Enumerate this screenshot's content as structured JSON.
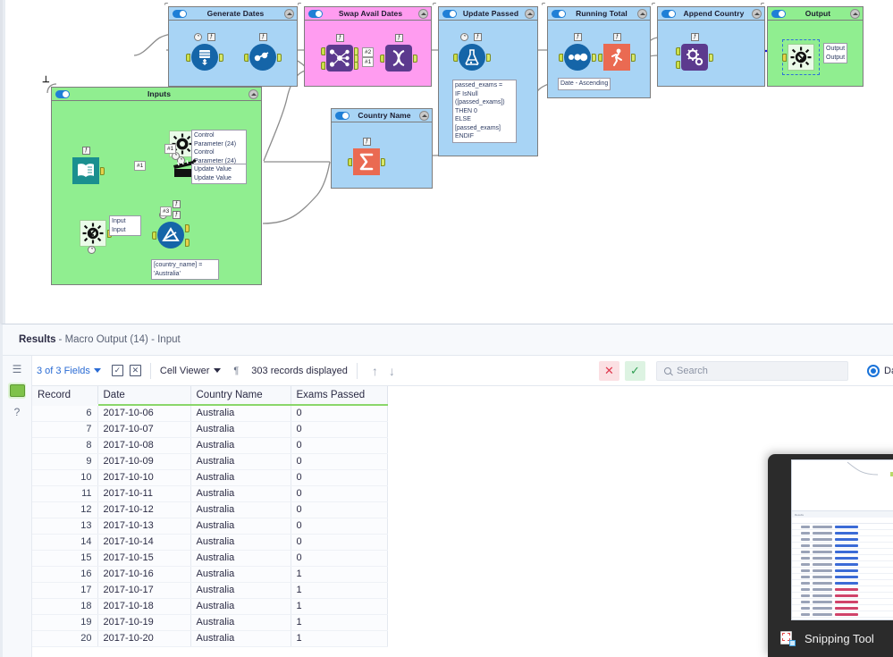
{
  "canvas": {
    "containers": [
      {
        "name": "Generate Dates",
        "color": "#a8d4f5"
      },
      {
        "name": "Swap Avail Dates",
        "color": "#ff9cf0"
      },
      {
        "name": "Update Passed",
        "color": "#a8d4f5"
      },
      {
        "name": "Running Total",
        "color": "#a8d4f5"
      },
      {
        "name": "Append Country",
        "color": "#a8d4f5"
      },
      {
        "name": "Output",
        "color": "#90ee90"
      },
      {
        "name": "Inputs",
        "color": "#90ee90"
      },
      {
        "name": "Country Name",
        "color": "#a8d4f5"
      }
    ],
    "notes": {
      "update_passed_formula": "passed_exams =\nIF IsNull\n([passed_exams])\nTHEN 0\nELSE\n[passed_exams]\nENDIF",
      "running_total_sort": "Date - Ascending",
      "output_label": "Output\nOutput",
      "control_parameter": "Control\nParameter (24)\nControl\nParameter (24)",
      "update_value": "Update Value\nUpdate Value",
      "macro_input_label": "Input\nInput",
      "filter_expression": "[country_name] =\n'Australia'"
    },
    "connection_labels": {
      "join_label": "#2",
      "text_input_label": "#1",
      "action_label": "#1",
      "filter_label": "#3"
    }
  },
  "results": {
    "header": {
      "lead": "Results",
      "sub": "- Macro Output (14) - Input"
    },
    "toolbar": {
      "fields_label": "3 of 3 Fields",
      "select_all_icon": "checkbox-icon",
      "deselect_all_icon": "x-box-icon",
      "cell_viewer_label": "Cell Viewer",
      "pilcrow_icon": "pilcrow-icon",
      "records_label": "303 records displayed",
      "up_arrow": "↑",
      "down_arrow": "↓",
      "cancel_label": "✕",
      "confirm_label": "✓",
      "search_placeholder": "Search",
      "data_radio_label": "Da"
    },
    "rail": {
      "list_icon": "list-icon",
      "data-chip-icon": "data-chip-icon",
      "help_icon": "help-icon"
    },
    "table": {
      "columns": [
        "Record",
        "Date",
        "Country Name",
        "Exams Passed"
      ],
      "rows": [
        [
          "6",
          "2017-10-06",
          "Australia",
          "0"
        ],
        [
          "7",
          "2017-10-07",
          "Australia",
          "0"
        ],
        [
          "8",
          "2017-10-08",
          "Australia",
          "0"
        ],
        [
          "9",
          "2017-10-09",
          "Australia",
          "0"
        ],
        [
          "10",
          "2017-10-10",
          "Australia",
          "0"
        ],
        [
          "11",
          "2017-10-11",
          "Australia",
          "0"
        ],
        [
          "12",
          "2017-10-12",
          "Australia",
          "0"
        ],
        [
          "13",
          "2017-10-13",
          "Australia",
          "0"
        ],
        [
          "14",
          "2017-10-14",
          "Australia",
          "0"
        ],
        [
          "15",
          "2017-10-15",
          "Australia",
          "0"
        ],
        [
          "16",
          "2017-10-16",
          "Australia",
          "1"
        ],
        [
          "17",
          "2017-10-17",
          "Australia",
          "1"
        ],
        [
          "18",
          "2017-10-18",
          "Australia",
          "1"
        ],
        [
          "19",
          "2017-10-19",
          "Australia",
          "1"
        ],
        [
          "20",
          "2017-10-20",
          "Australia",
          "1"
        ]
      ]
    }
  },
  "toast": {
    "app_label": "Snipping Tool",
    "icon": "snipping-tool-icon"
  }
}
